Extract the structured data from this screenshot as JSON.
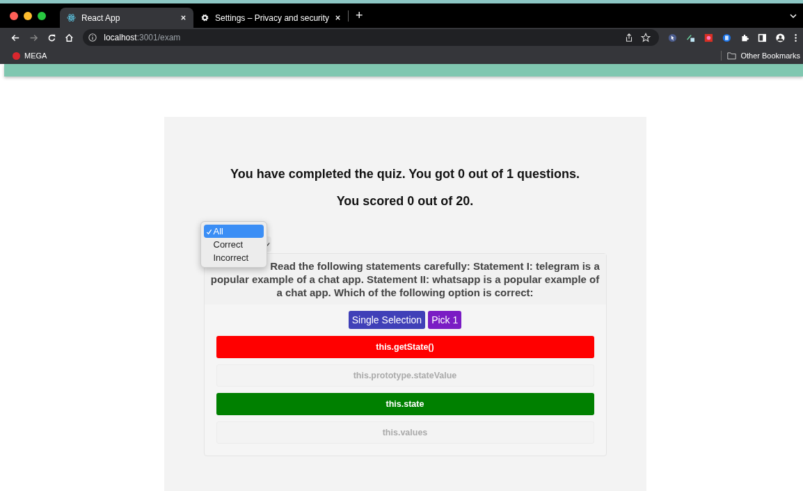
{
  "browser": {
    "tabs": [
      {
        "title": "React App",
        "selected": true,
        "kind": "react"
      },
      {
        "title": "Settings – Privacy and security",
        "selected": false,
        "kind": "gear"
      }
    ],
    "new_tab": "+",
    "address": {
      "host": "localhost",
      "path": ":3001/exam"
    },
    "bookmarks": [
      {
        "title": "MEGA"
      }
    ],
    "other_bookmarks": "Other Bookmarks"
  },
  "result": {
    "summary": "You have completed the quiz. You got 0 out of 1 questions.",
    "score": "You scored 0 out of 20."
  },
  "filter": {
    "options": [
      {
        "label": "All",
        "selected": true
      },
      {
        "label": "Correct",
        "selected": false
      },
      {
        "label": "Incorrect",
        "selected": false
      }
    ]
  },
  "question": {
    "text": "Read the following statements carefully: Statement I: telegram is a popular example of a chat app. Statement II: whatsapp is a popular example of a chat app. Which of the following option is correct:",
    "tags": [
      {
        "label": "Single Selection",
        "color": "#4040b8"
      },
      {
        "label": "Pick 1",
        "color": "#7a1cc4"
      }
    ],
    "options": [
      {
        "label": "this.getState()",
        "kind": "wrong"
      },
      {
        "label": "this.prototype.stateValue",
        "kind": "neutral"
      },
      {
        "label": "this.state",
        "kind": "correct"
      },
      {
        "label": "this.values",
        "kind": "neutral"
      }
    ]
  }
}
